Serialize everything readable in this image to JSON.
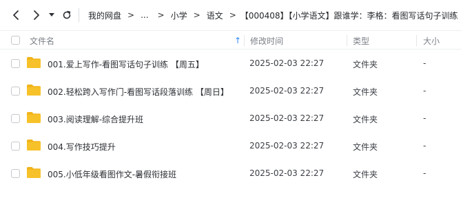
{
  "nav": {
    "back_icon": "chevron-left-icon",
    "forward_icon": "chevron-right-icon",
    "history_icon": "caret-down-icon",
    "refresh_icon": "refresh-icon"
  },
  "breadcrumb": {
    "items": [
      "我的网盘",
      "...",
      "小学",
      "语文",
      "【000408】【小学语文】跟谁学：李格：看图写话句子训练"
    ],
    "separator": ">"
  },
  "table": {
    "headers": {
      "name": "文件名",
      "modified": "修改时间",
      "type": "类型",
      "size": "大小"
    },
    "sort_indicator": "↑",
    "rows": [
      {
        "name": "001.爱上写作-看图写话句子训练 【周五】",
        "modified": "2025-02-03 22:27",
        "type": "文件夹",
        "size": "-"
      },
      {
        "name": "002.轻松跨入写作门-看图写话段落训练 【周日】",
        "modified": "2025-02-03 22:27",
        "type": "文件夹",
        "size": "-"
      },
      {
        "name": "003.阅读理解-综合提升班",
        "modified": "2025-02-03 22:27",
        "type": "文件夹",
        "size": "-"
      },
      {
        "name": "004.写作技巧提升",
        "modified": "2025-02-03 22:27",
        "type": "文件夹",
        "size": "-"
      },
      {
        "name": "005.小低年级看图作文-暑假衔接班",
        "modified": "2025-02-03 22:27",
        "type": "文件夹",
        "size": "-"
      }
    ]
  },
  "colors": {
    "folder": "#f7c229",
    "folder_tab": "#f0b31a",
    "accent": "#2a86f5"
  }
}
